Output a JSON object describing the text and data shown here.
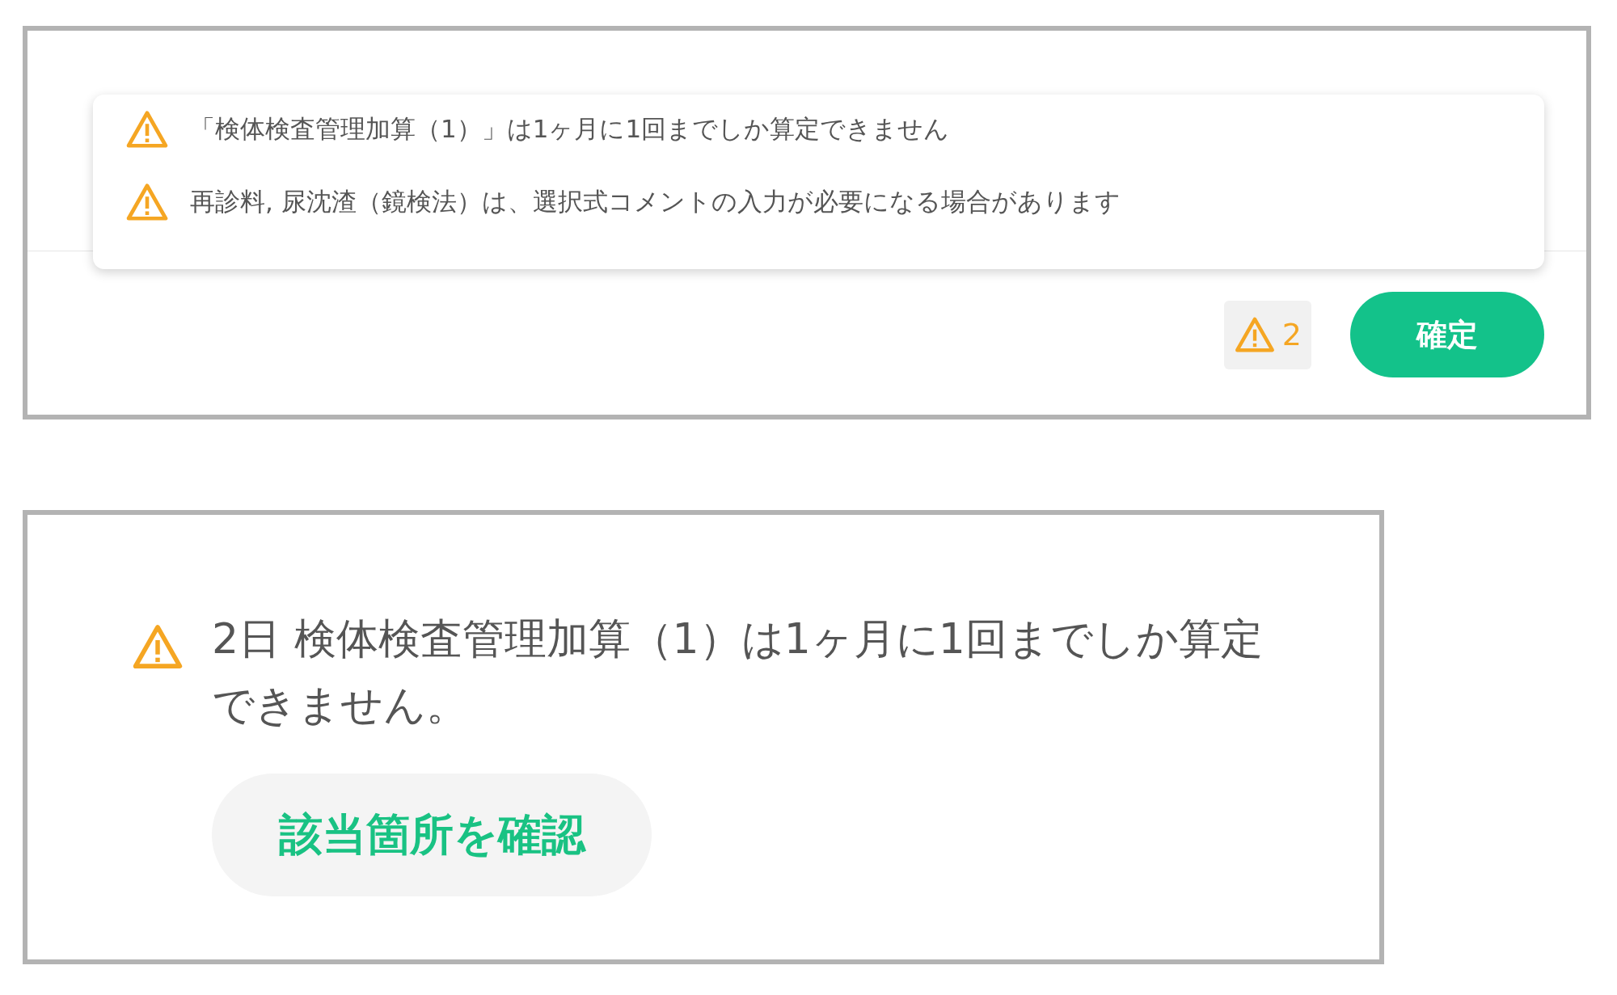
{
  "alerts_panel": {
    "messages": [
      {
        "text": "「検体検査管理加算（1）」は1ヶ月に1回までしか算定できません"
      },
      {
        "text": "再診料, 尿沈渣（鏡検法）は、選択式コメントの入力が必要になる場合があります"
      }
    ],
    "warning_count": "2",
    "confirm_button": "確定"
  },
  "alert_card": {
    "message": "2日 検体検査管理加算（1）は1ヶ月に1回までしか算定できません。",
    "action_button": "該当箇所を確認"
  }
}
